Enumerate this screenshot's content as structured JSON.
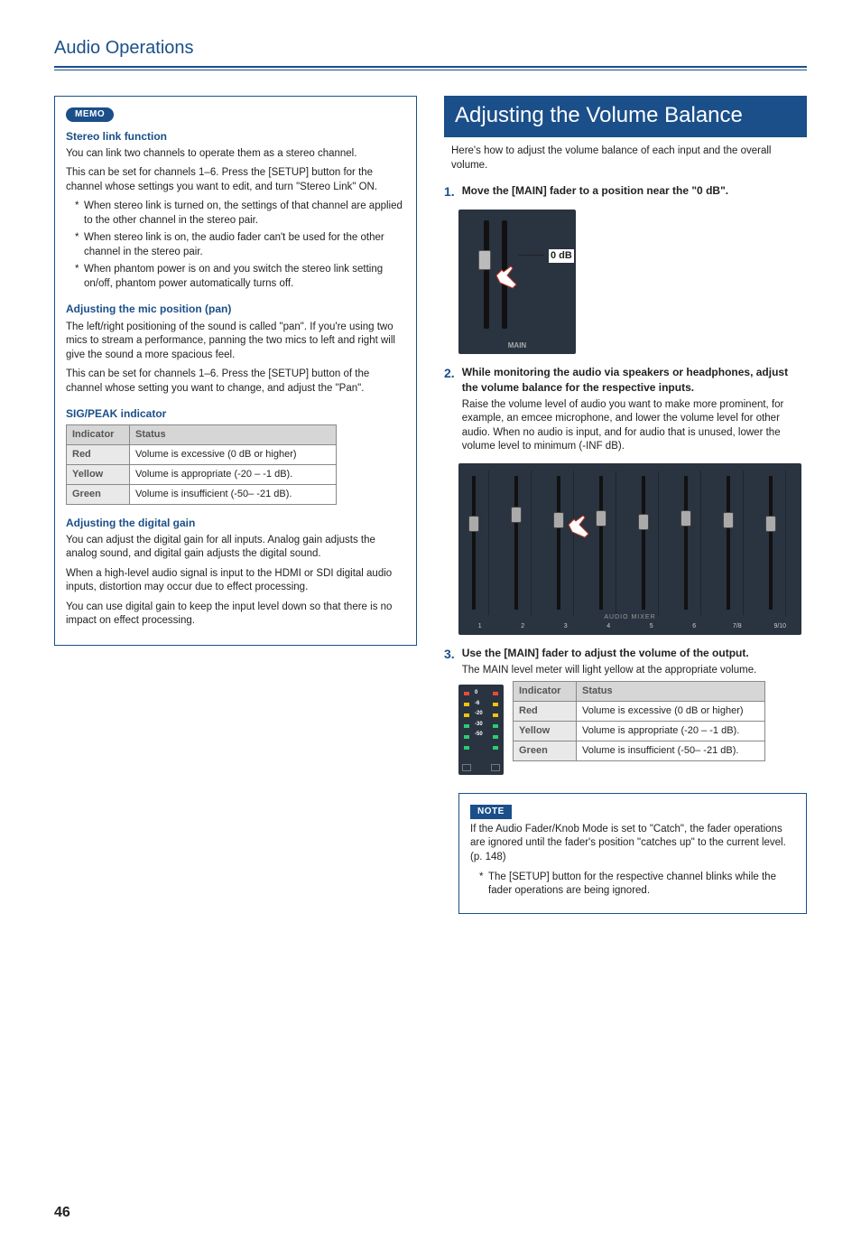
{
  "header": {
    "title": "Audio Operations"
  },
  "memo": {
    "badge": "MEMO",
    "stereo": {
      "title": "Stereo link function",
      "p1": "You can link two channels to operate them as a stereo channel.",
      "p2": "This can be set for channels 1–6. Press the [SETUP] button for the channel whose settings you want to edit, and turn \"Stereo Link\" ON.",
      "bullets": [
        "When stereo link is turned on, the settings of that channel are applied to the other channel in the stereo pair.",
        "When stereo link is on, the audio fader can't be used for the other channel in the stereo pair.",
        "When phantom power is on and you switch the stereo link setting on/off, phantom power automatically turns off."
      ]
    },
    "pan": {
      "title": "Adjusting the mic position (pan)",
      "p1": "The left/right positioning of the sound is called \"pan\". If you're using two mics to stream a performance, panning the two mics to left and right will give the sound a more spacious feel.",
      "p2": "This can be set for channels 1–6. Press the [SETUP] button of the channel whose setting you want to change, and adjust the \"Pan\"."
    },
    "sigpeak": {
      "title": "SIG/PEAK indicator",
      "headers": {
        "indicator": "Indicator",
        "status": "Status"
      },
      "rows": [
        {
          "label": "Red",
          "status": "Volume is excessive (0 dB or higher)"
        },
        {
          "label": "Yellow",
          "status": "Volume is appropriate (-20 – -1 dB)."
        },
        {
          "label": "Green",
          "status": "Volume is insufficient (-50– -21 dB)."
        }
      ]
    },
    "digital": {
      "title": "Adjusting the digital gain",
      "p1": "You can adjust the digital gain for all inputs. Analog gain adjusts the analog sound, and digital gain adjusts the digital sound.",
      "p2": "When a high-level audio signal is input to the HDMI or SDI digital audio inputs, distortion may occur due to effect processing.",
      "p3": "You can use digital gain to keep the input level down so that there is no impact on effect processing."
    }
  },
  "right": {
    "banner": "Adjusting the Volume Balance",
    "intro": "Here's how to adjust the volume balance of each input and the overall volume.",
    "step1": {
      "num": "1.",
      "text": "Move the [MAIN] fader to a position near the \"0 dB\".",
      "label0db": "0 dB",
      "mainLabel": "MAIN"
    },
    "step2": {
      "num": "2.",
      "text": "While monitoring the audio via speakers or headphones, adjust the volume balance for the respective inputs.",
      "body": "Raise the volume level of audio you want to make more prominent, for example, an emcee microphone, and lower the volume level for other audio. When no audio is input, and for audio that is unused, lower the volume level to minimum (-INF dB).",
      "mixerTitle": "AUDIO MIXER",
      "channels": [
        "1",
        "2",
        "3",
        "4",
        "5",
        "6",
        "7/8",
        "9/10"
      ]
    },
    "step3": {
      "num": "3.",
      "text": "Use the [MAIN] fader to adjust the volume of the output.",
      "body": "The MAIN level meter will light yellow at the appropriate volume.",
      "meterLabels": [
        "0",
        "-6",
        "-20",
        "-30",
        "-50"
      ],
      "tableHeaders": {
        "indicator": "Indicator",
        "status": "Status"
      },
      "rows": [
        {
          "label": "Red",
          "status": "Volume is excessive (0 dB or higher)"
        },
        {
          "label": "Yellow",
          "status": "Volume is appropriate (-20 – -1 dB)."
        },
        {
          "label": "Green",
          "status": "Volume is insufficient (-50– -21 dB)."
        }
      ]
    },
    "note": {
      "label": "NOTE",
      "p1": "If the Audio Fader/Knob Mode is set to \"Catch\", the fader operations are ignored until the fader's position \"catches up\" to the current level. (p. 148)",
      "bullet": "The [SETUP] button for the respective channel blinks while the fader operations are being ignored."
    }
  },
  "footer": {
    "page": "46"
  }
}
